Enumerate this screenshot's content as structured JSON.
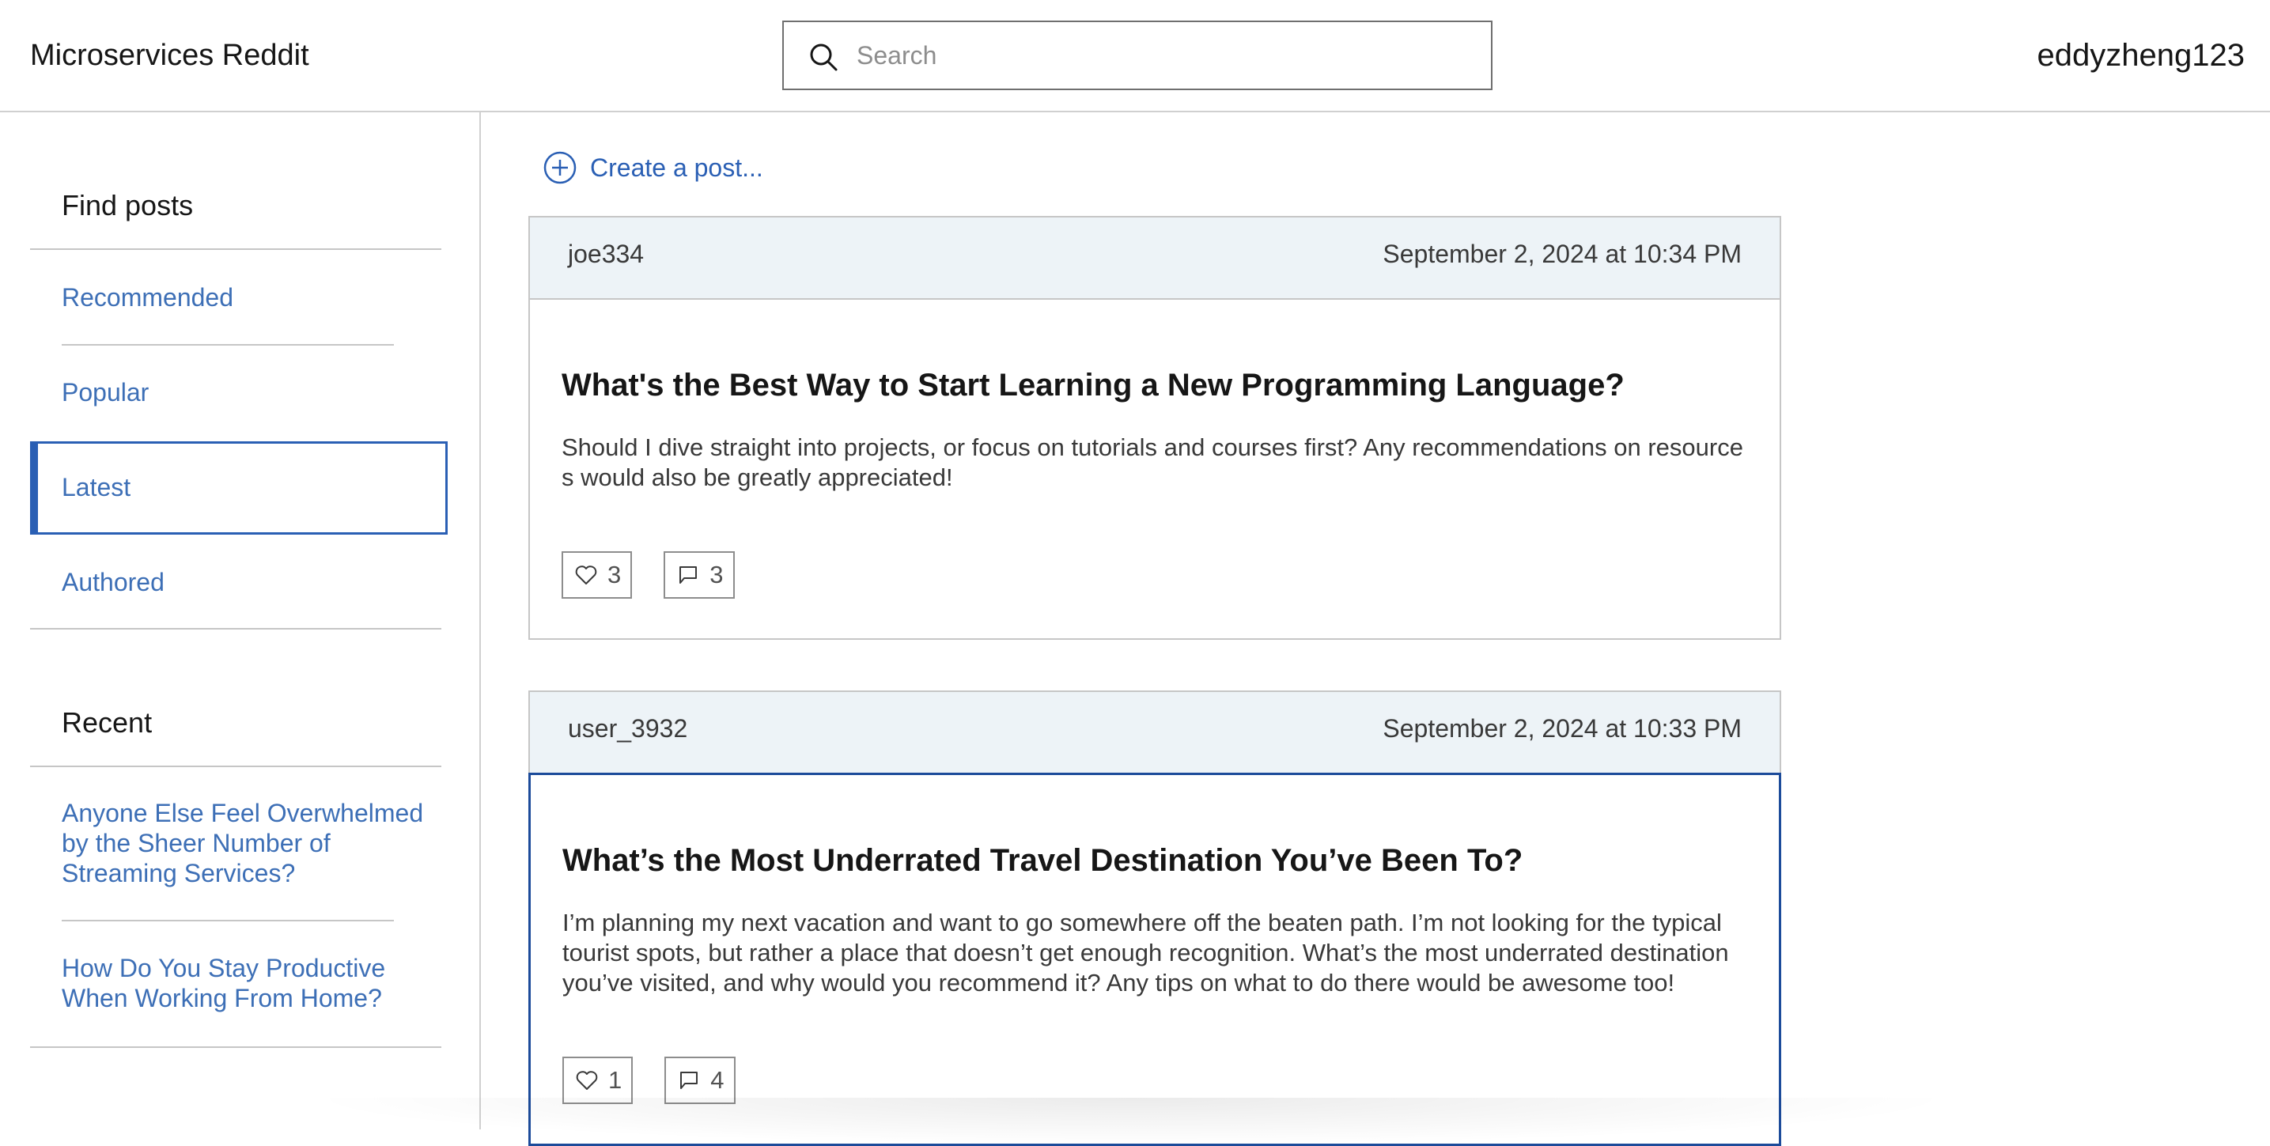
{
  "header": {
    "app_title": "Microservices Reddit",
    "search_placeholder": "Search",
    "search_value": "",
    "username": "eddyzheng123"
  },
  "sidebar": {
    "find_heading": "Find posts",
    "find_items": [
      {
        "label": "Recommended",
        "active": false
      },
      {
        "label": "Popular",
        "active": false
      },
      {
        "label": "Latest",
        "active": true
      },
      {
        "label": "Authored",
        "active": false
      }
    ],
    "recent_heading": "Recent",
    "recent_items": [
      {
        "label": "Anyone Else Feel Overwhelmed by the Sheer Number of Streaming Services?"
      },
      {
        "label": "How Do You Stay Productive When Working From Home?"
      }
    ]
  },
  "main": {
    "create_post_label": "Create a post...",
    "posts": [
      {
        "author": "joe334",
        "date": "September 2, 2024 at 10:34 PM",
        "title": "What's the Best Way to Start Learning a New Programming Language?",
        "body": "Should I dive straight into projects, or focus on tutorials and courses first? Any recommendations on resources would also be greatly appreciated!",
        "likes": "3",
        "comments": "3"
      },
      {
        "author": "user_3932",
        "date": "September 2, 2024 at 10:33 PM",
        "title": "What’s the Most Underrated Travel Destination You’ve Been To?",
        "body": "I’m planning my next vacation and want to go somewhere off the beaten path. I’m not looking for the typical tourist spots, but rather a place that doesn’t get enough recognition. What’s the most underrated destination you’ve visited, and why would you recommend it? Any tips on what to do there would be awesome too!",
        "likes": "1",
        "comments": "4"
      }
    ]
  },
  "colors": {
    "accent": "#2a5fb4",
    "link": "#3d6fb6",
    "post_header_bg": "#edf3f7",
    "border": "#c6c6c6"
  },
  "icons": {
    "search": "search-icon",
    "create": "plus-circle-icon",
    "like": "heart-icon",
    "comment": "comment-icon"
  }
}
